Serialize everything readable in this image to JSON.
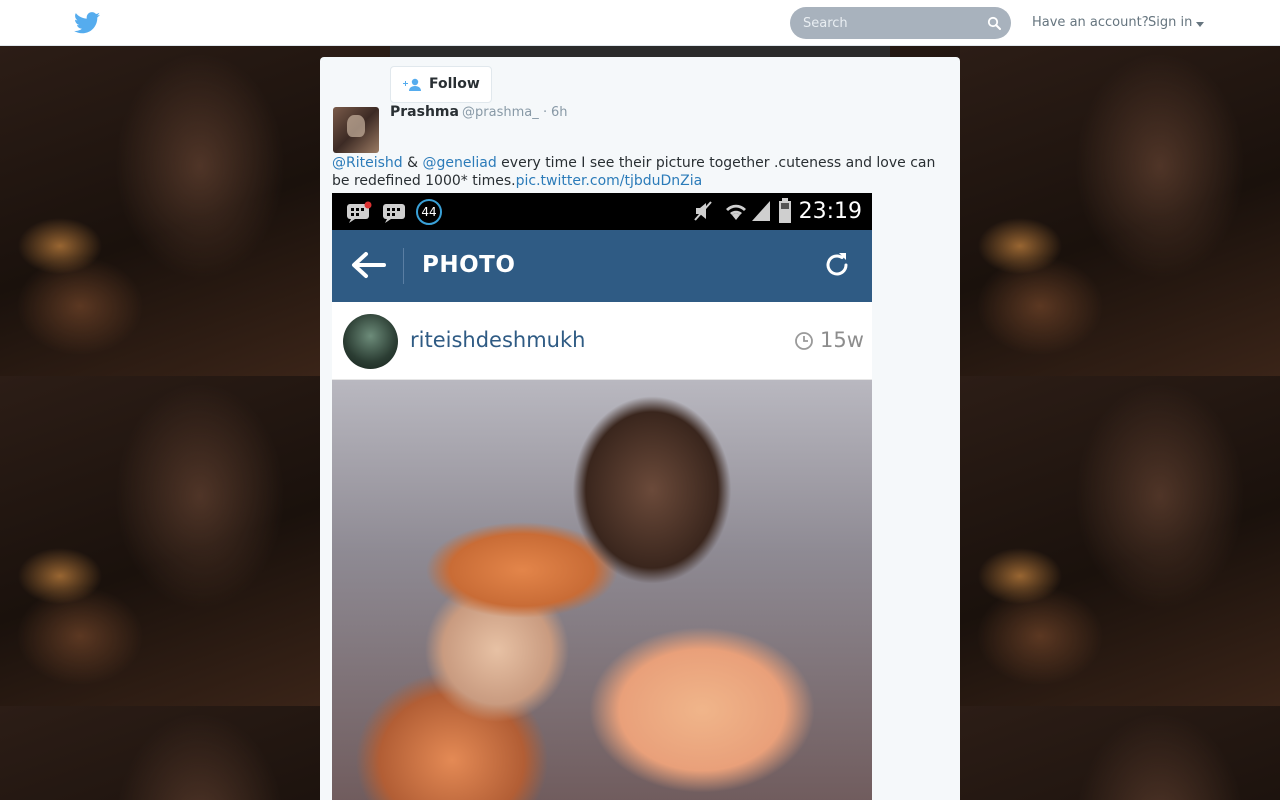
{
  "topbar": {
    "search_placeholder": "Search",
    "account_prompt": "Have an account?",
    "signin_label": "Sign in"
  },
  "tweet": {
    "follow_label": "Follow",
    "fullname": "Prashma",
    "username": "@prashma_",
    "separator": "·",
    "time": "6h",
    "mention1": "@Riteishd",
    "amp": " & ",
    "mention2": "@geneliad",
    "body": " every time I see their picture together .cuteness and love can be redefined 1000* times.",
    "pic_link": "pic.twitter.com/tjbduDnZia"
  },
  "media": {
    "status_clock": "23:19",
    "badge_count": "44",
    "screen_title": "PHOTO",
    "ig_username": "riteishdeshmukh",
    "ig_age": "15w"
  },
  "colors": {
    "link": "#2b7bb9",
    "twitter_blue": "#55acee",
    "instagram_bar": "#2f5b84"
  }
}
